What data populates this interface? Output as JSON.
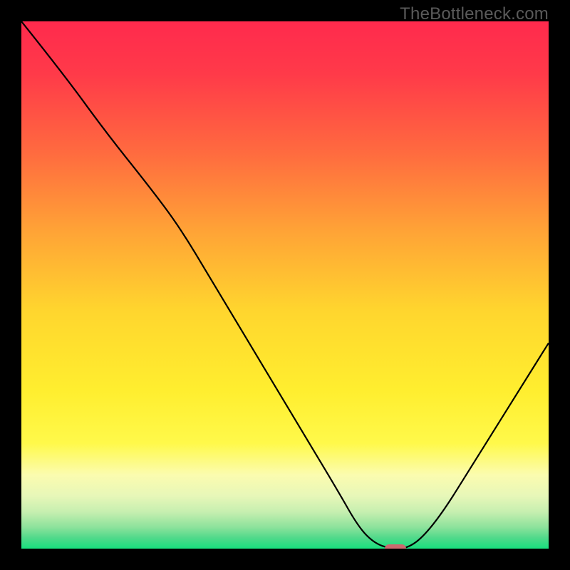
{
  "watermark": "TheBottleneck.com",
  "chart_data": {
    "type": "line",
    "title": "",
    "xlabel": "",
    "ylabel": "",
    "xlim": [
      0,
      100
    ],
    "ylim": [
      0,
      100
    ],
    "gradient_stops": [
      {
        "offset": 0,
        "color": "#ff2a4d"
      },
      {
        "offset": 10,
        "color": "#ff3a49"
      },
      {
        "offset": 25,
        "color": "#ff6b3f"
      },
      {
        "offset": 40,
        "color": "#ffa436"
      },
      {
        "offset": 55,
        "color": "#ffd62e"
      },
      {
        "offset": 70,
        "color": "#ffee2f"
      },
      {
        "offset": 80,
        "color": "#fff94a"
      },
      {
        "offset": 86,
        "color": "#fbfcaf"
      },
      {
        "offset": 90,
        "color": "#e7f7b8"
      },
      {
        "offset": 93,
        "color": "#c7efb0"
      },
      {
        "offset": 96,
        "color": "#8be29b"
      },
      {
        "offset": 98,
        "color": "#4fd98a"
      },
      {
        "offset": 100,
        "color": "#18e07e"
      }
    ],
    "series": [
      {
        "name": "bottleneck-curve",
        "color": "#000000",
        "points": [
          {
            "x": 0,
            "y": 100
          },
          {
            "x": 8,
            "y": 90
          },
          {
            "x": 16,
            "y": 79
          },
          {
            "x": 24,
            "y": 69
          },
          {
            "x": 30,
            "y": 61
          },
          {
            "x": 36,
            "y": 51
          },
          {
            "x": 42,
            "y": 41
          },
          {
            "x": 48,
            "y": 31
          },
          {
            "x": 54,
            "y": 21
          },
          {
            "x": 60,
            "y": 11
          },
          {
            "x": 64,
            "y": 4
          },
          {
            "x": 67,
            "y": 1
          },
          {
            "x": 70,
            "y": 0
          },
          {
            "x": 73,
            "y": 0
          },
          {
            "x": 76,
            "y": 2
          },
          {
            "x": 80,
            "y": 7
          },
          {
            "x": 85,
            "y": 15
          },
          {
            "x": 90,
            "y": 23
          },
          {
            "x": 95,
            "y": 31
          },
          {
            "x": 100,
            "y": 39
          }
        ]
      }
    ],
    "marker": {
      "x": 71,
      "y": 0,
      "color": "#cc6a6f"
    }
  }
}
